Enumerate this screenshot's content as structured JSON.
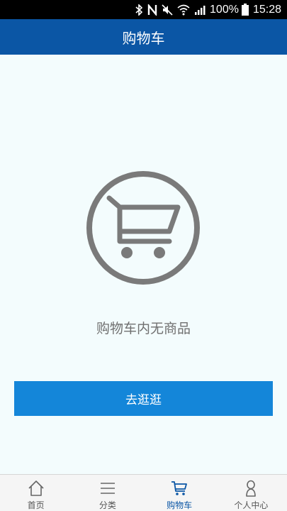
{
  "status_bar": {
    "battery": "100%",
    "time": "15:28",
    "icons": [
      "bluetooth-icon",
      "nfc-icon",
      "mute-icon",
      "wifi-icon",
      "signal-icon",
      "battery-icon"
    ]
  },
  "header": {
    "title": "购物车"
  },
  "empty_state": {
    "icon": "shopping-cart-icon",
    "message": "购物车内无商品",
    "button_label": "去逛逛"
  },
  "tab_bar": {
    "active_color": "#0b56a5",
    "items": [
      {
        "label": "首页",
        "icon": "home-icon"
      },
      {
        "label": "分类",
        "icon": "menu-icon"
      },
      {
        "label": "购物车",
        "icon": "cart-icon"
      },
      {
        "label": "个人中心",
        "icon": "user-icon"
      }
    ],
    "active_index": 2
  },
  "colors": {
    "header_bg": "#0b56a5",
    "button_bg": "#1486d9",
    "page_bg": "#f3fcfd",
    "icon_gray": "#7a7a7a"
  }
}
